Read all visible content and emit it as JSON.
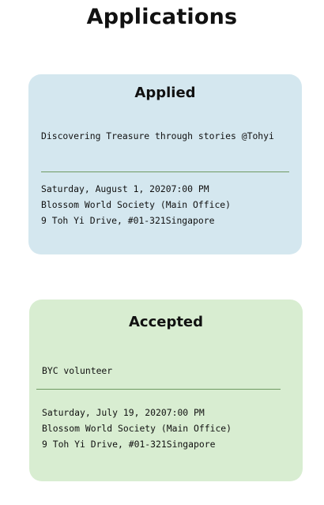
{
  "page": {
    "title": "Applications"
  },
  "cards": [
    {
      "status": "Applied",
      "event_name": "Discovering Treasure through stories @Tohyi",
      "datetime": "Saturday, August 1, 20207:00 PM",
      "venue": "Blossom World Society (Main Office)",
      "address": "9 Toh Yi Drive, #01-321Singapore",
      "background": "#d4e7ef"
    },
    {
      "status": "Accepted",
      "event_name": "BYC volunteer",
      "datetime": "Saturday, July 19, 20207:00 PM",
      "venue": "Blossom World Society (Main Office)",
      "address": "9 Toh Yi Drive, #01-321Singapore",
      "background": "#d8edd1"
    }
  ],
  "colors": {
    "divider": "#6f9a62",
    "text": "#111111"
  }
}
